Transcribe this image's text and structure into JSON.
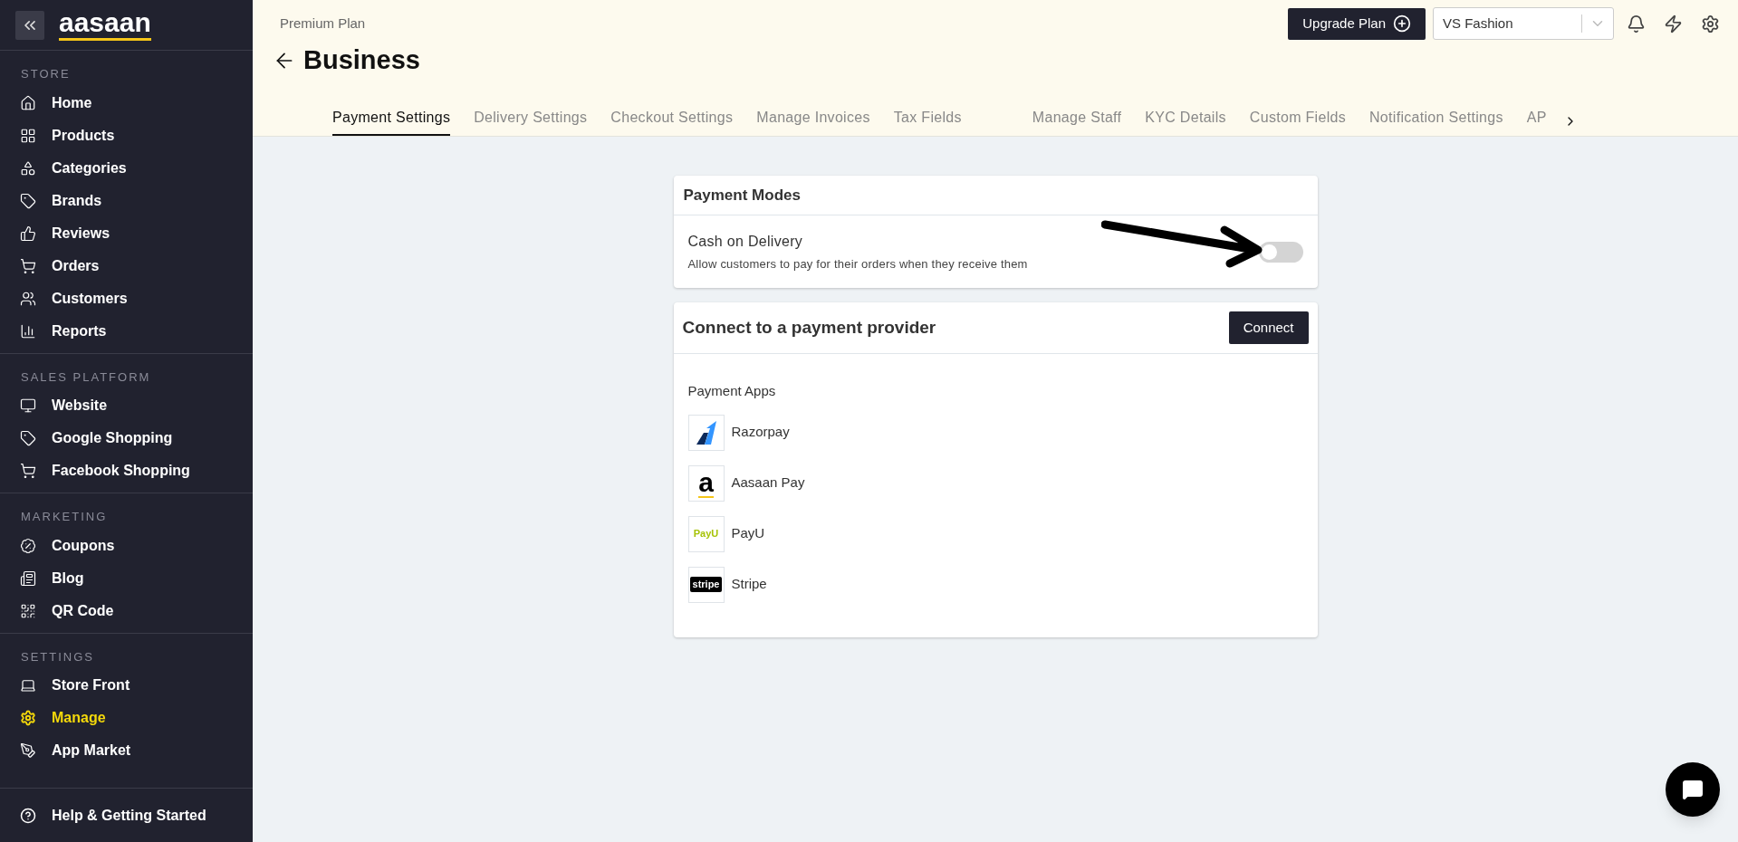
{
  "sidebar": {
    "logo": "aasaan",
    "sections": [
      {
        "title": "STORE",
        "items": [
          {
            "kind": "home",
            "label": "Home",
            "selected": false
          },
          {
            "kind": "products",
            "label": "Products",
            "selected": false
          },
          {
            "kind": "categories",
            "label": "Categories",
            "selected": false
          },
          {
            "kind": "tag",
            "label": "Brands",
            "selected": false
          },
          {
            "kind": "reviews",
            "label": "Reviews",
            "selected": false
          },
          {
            "kind": "cart",
            "label": "Orders",
            "selected": false
          },
          {
            "kind": "users",
            "label": "Customers",
            "selected": false
          },
          {
            "kind": "chart",
            "label": "Reports",
            "selected": false
          }
        ]
      },
      {
        "title": "SALES PLATFORM",
        "items": [
          {
            "kind": "monitor",
            "label": "Website",
            "selected": false
          },
          {
            "kind": "google",
            "label": "Google Shopping",
            "selected": false
          },
          {
            "kind": "cart",
            "label": "Facebook Shopping",
            "selected": false
          }
        ]
      },
      {
        "title": "MARKETING",
        "items": [
          {
            "kind": "coupon",
            "label": "Coupons",
            "selected": false
          },
          {
            "kind": "blog",
            "label": "Blog",
            "selected": false
          },
          {
            "kind": "qr",
            "label": "QR Code",
            "selected": false
          }
        ]
      },
      {
        "title": "SETTINGS",
        "items": [
          {
            "kind": "storefront",
            "label": "Store Front",
            "selected": false
          },
          {
            "kind": "gear",
            "label": "Manage",
            "selected": true
          },
          {
            "kind": "appmarket",
            "label": "App Market",
            "selected": false
          }
        ]
      }
    ],
    "help": "Help & Getting Started"
  },
  "header": {
    "plan": "Premium Plan",
    "upgrade_button": "Upgrade Plan",
    "store_select": "VS Fashion",
    "title": "Business"
  },
  "tabs": [
    {
      "label": "Payment Settings",
      "selected": true
    },
    {
      "label": "Delivery Settings",
      "selected": false
    },
    {
      "label": "Checkout Settings",
      "selected": false
    },
    {
      "label": "Manage Invoices",
      "selected": false
    },
    {
      "label": "Tax Fields",
      "selected": false
    },
    {
      "label": "Manage Staff",
      "selected": false
    },
    {
      "label": "KYC Details",
      "selected": false
    },
    {
      "label": "Custom Fields",
      "selected": false
    },
    {
      "label": "Notification Settings",
      "selected": false
    },
    {
      "label": "AP",
      "selected": false
    }
  ],
  "payment_modes": {
    "title": "Payment Modes",
    "items": [
      {
        "label": "Cash on Delivery",
        "description": "Allow customers to pay for their orders when they receive them",
        "on": false
      }
    ]
  },
  "provider": {
    "title": "Connect to a payment provider",
    "button": "Connect",
    "apps_title": "Payment Apps",
    "apps": [
      {
        "kind": "razorpay",
        "name": "Razorpay"
      },
      {
        "kind": "aasaan",
        "logo_text": "a",
        "name": "Aasaan Pay"
      },
      {
        "kind": "payu",
        "logo_text": "PayU",
        "name": "PayU"
      },
      {
        "kind": "stripe",
        "logo_text": "stripe",
        "name": "Stripe"
      }
    ]
  }
}
